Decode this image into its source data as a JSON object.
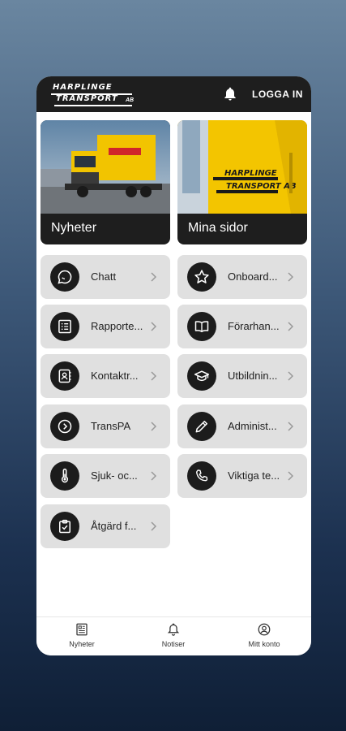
{
  "header": {
    "logo_line1": "HARPLINGE",
    "logo_line2": "TRANSPORT",
    "logo_suffix": "AB",
    "login_label": "LOGGA IN"
  },
  "cards": [
    {
      "label": "Nyheter",
      "icon": "truck-photo"
    },
    {
      "label": "Mina sidor",
      "icon": "truck-door-photo"
    }
  ],
  "tiles": [
    {
      "label": "Chatt",
      "icon": "chat-bubble-icon"
    },
    {
      "label": "Onboard...",
      "icon": "star-icon"
    },
    {
      "label": "Rapporte...",
      "icon": "list-icon"
    },
    {
      "label": "Förarhan...",
      "icon": "book-icon"
    },
    {
      "label": "Kontaktr...",
      "icon": "contact-book-icon"
    },
    {
      "label": "Utbildnin...",
      "icon": "graduation-cap-icon"
    },
    {
      "label": "TransPA",
      "icon": "chevron-circle-icon"
    },
    {
      "label": "Administ...",
      "icon": "pencil-icon"
    },
    {
      "label": "Sjuk- oc...",
      "icon": "thermometer-icon"
    },
    {
      "label": "Viktiga te...",
      "icon": "phone-icon"
    },
    {
      "label": "Åtgärd f...",
      "icon": "clipboard-check-icon"
    }
  ],
  "bottom_nav": [
    {
      "label": "Nyheter",
      "icon": "newspaper-icon"
    },
    {
      "label": "Notiser",
      "icon": "bell-icon"
    },
    {
      "label": "Mitt konto",
      "icon": "user-circle-icon"
    }
  ],
  "colors": {
    "topbar": "#1e1e1e",
    "tile_bg": "#e0e0e0",
    "icon_circle": "#1c1c1c",
    "accent_yellow": "#f2c400"
  }
}
